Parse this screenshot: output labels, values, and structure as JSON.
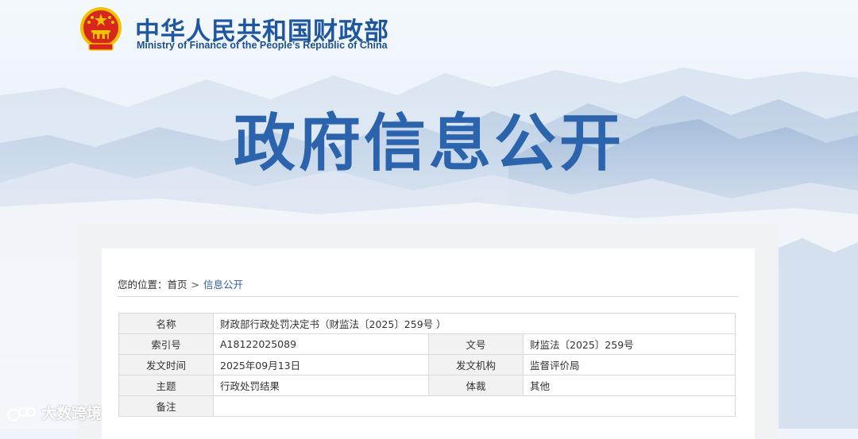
{
  "site": {
    "title_cn": "中华人民共和国财政部",
    "title_en": "Ministry of Finance of the People’s Republic of China",
    "headline": "政府信息公开"
  },
  "breadcrumb": {
    "prefix": "您的位置：",
    "home": "首页",
    "separator": ">",
    "current": "信息公开"
  },
  "info_table": {
    "name_label": "名称",
    "name_value": "财政部行政处罚决定书（财监法〔2025〕259号 ）",
    "index_label": "索引号",
    "index_value": "A18122025089",
    "doc_no_label": "文号",
    "doc_no_value": "财监法〔2025〕259号",
    "date_label": "发文时间",
    "date_value": "2025年09月13日",
    "issuer_label": "发文机构",
    "issuer_value": "监督评价局",
    "topic_label": "主题",
    "topic_value": "行政处罚结果",
    "genre_label": "体裁",
    "genre_value": "其他",
    "note_label": "备注",
    "note_value": ""
  },
  "watermark": {
    "text": "大数跨境"
  },
  "colors": {
    "brand_blue": "#1e56a0",
    "headline_blue": "#2b63ad",
    "link_blue": "#2a5ea8",
    "emblem_red": "#d7261e",
    "emblem_gold": "#f2c200"
  },
  "icons": {
    "emblem": "national-emblem-icon",
    "watermark_logo": "watermark-logo-icon"
  }
}
